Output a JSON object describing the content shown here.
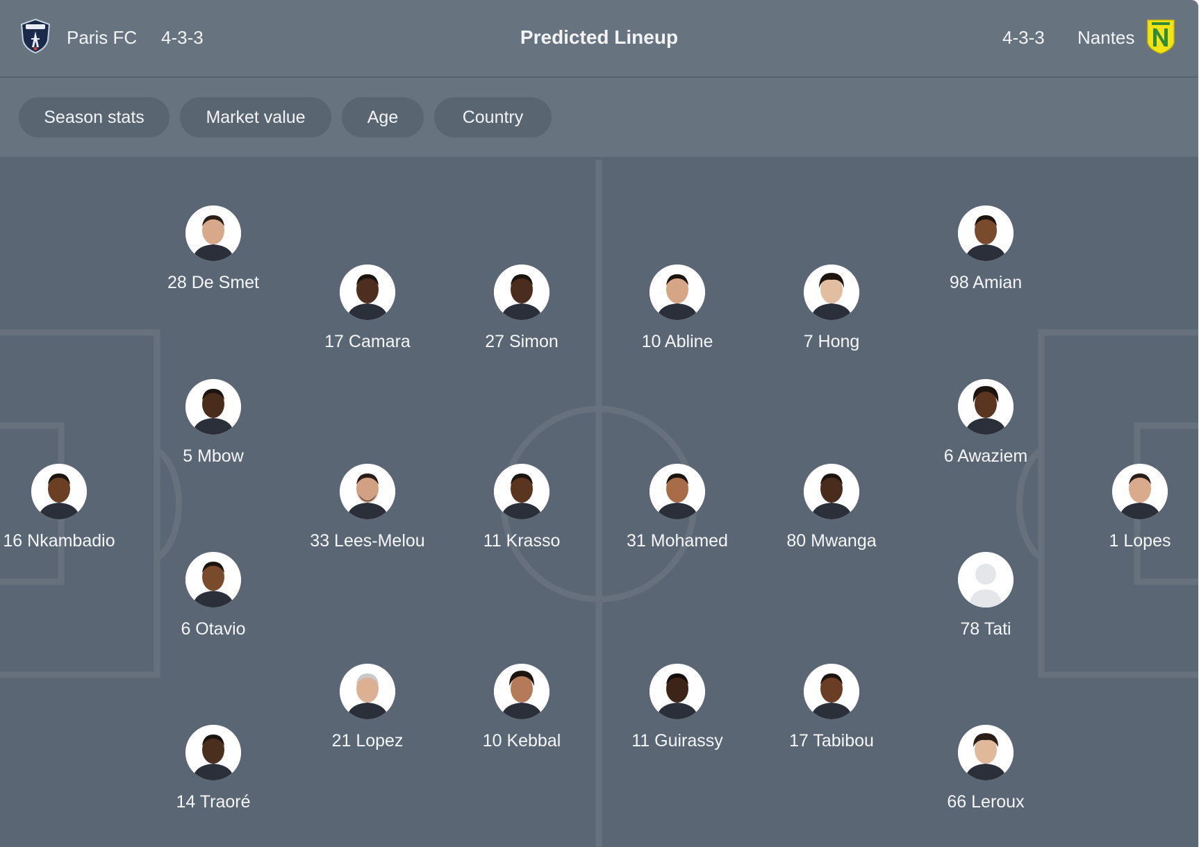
{
  "header": {
    "title": "Predicted Lineup",
    "home": {
      "name": "Paris FC",
      "formation": "4-3-3",
      "crest_icon": "paris-fc-crest-icon"
    },
    "away": {
      "name": "Nantes",
      "formation": "4-3-3",
      "crest_icon": "fc-nantes-crest-icon"
    }
  },
  "filters": [
    "Season stats",
    "Market value",
    "Age",
    "Country"
  ],
  "colors": {
    "panel": "#5b6674",
    "header": "#687380",
    "pill": "#5a6572",
    "pitch_line": "#67717e",
    "text": "#f2f4f6",
    "nantes_yellow": "#f4e415",
    "nantes_green": "#2e8b3a",
    "paris_navy": "#1b2a4a"
  },
  "players": {
    "home": [
      {
        "number": "16",
        "name": "Nkambadio",
        "label": "16 Nkambadio",
        "skin": "#6b3f24"
      },
      {
        "number": "28",
        "name": "De Smet",
        "label": "28 De Smet",
        "skin": "#d7a88a"
      },
      {
        "number": "5",
        "name": "Mbow",
        "label": "5 Mbow",
        "skin": "#4a2c1c"
      },
      {
        "number": "6",
        "name": "Otavio",
        "label": "6 Otavio",
        "skin": "#7a4a2c"
      },
      {
        "number": "14",
        "name": "Traoré",
        "label": "14 Traoré",
        "skin": "#4a2e1e"
      },
      {
        "number": "17",
        "name": "Camara",
        "label": "17 Camara",
        "skin": "#4e2f1f"
      },
      {
        "number": "33",
        "name": "Lees-Melou",
        "label": "33 Lees-Melou",
        "skin": "#d2a184"
      },
      {
        "number": "21",
        "name": "Lopez",
        "label": "21 Lopez",
        "skin": "#dcb093"
      },
      {
        "number": "27",
        "name": "Simon",
        "label": "27 Simon",
        "skin": "#4b2d1d"
      },
      {
        "number": "11",
        "name": "Krasso",
        "label": "11 Krasso",
        "skin": "#5a3520"
      },
      {
        "number": "10",
        "name": "Kebbal",
        "label": "10 Kebbal",
        "skin": "#b57b58"
      }
    ],
    "away": [
      {
        "number": "10",
        "name": "Abline",
        "label": "10 Abline",
        "skin": "#d6a586"
      },
      {
        "number": "31",
        "name": "Mohamed",
        "label": "31 Mohamed",
        "skin": "#a86d48"
      },
      {
        "number": "11",
        "name": "Guirassy",
        "label": "11 Guirassy",
        "skin": "#3c2418"
      },
      {
        "number": "7",
        "name": "Hong",
        "label": "7 Hong",
        "skin": "#e2bd9f"
      },
      {
        "number": "80",
        "name": "Mwanga",
        "label": "80 Mwanga",
        "skin": "#4a2c1c"
      },
      {
        "number": "17",
        "name": "Tabibou",
        "label": "17 Tabibou",
        "skin": "#6a3e24"
      },
      {
        "number": "98",
        "name": "Amian",
        "label": "98 Amian",
        "skin": "#7a4a2c"
      },
      {
        "number": "6",
        "name": "Awaziem",
        "label": "6 Awaziem",
        "skin": "#5a3520"
      },
      {
        "number": "78",
        "name": "Tati",
        "label": "78 Tati",
        "skin": "placeholder"
      },
      {
        "number": "66",
        "name": "Leroux",
        "label": "66 Leroux",
        "skin": "#e0b89a"
      },
      {
        "number": "1",
        "name": "Lopes",
        "label": "1 Lopes",
        "skin": "#d9ab8c"
      }
    ]
  }
}
